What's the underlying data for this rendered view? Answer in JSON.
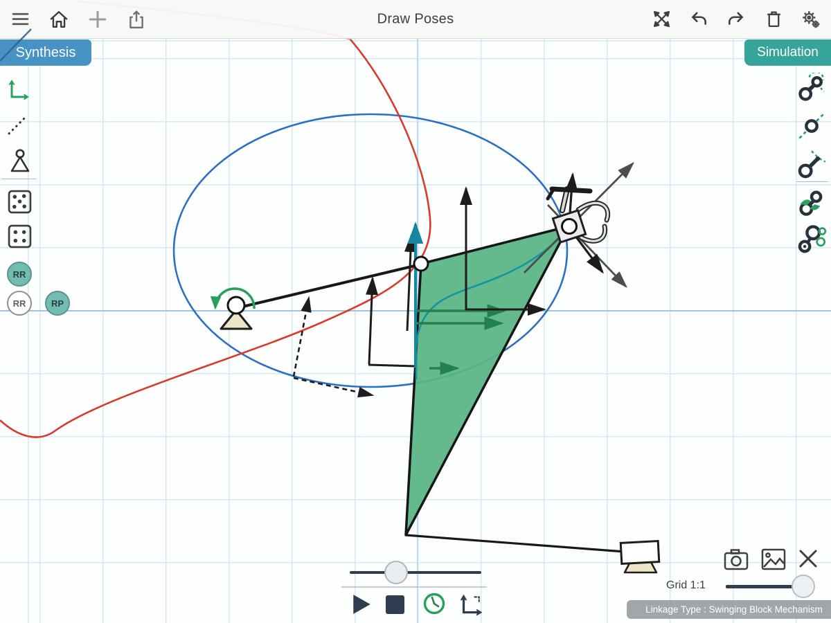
{
  "toolbar": {
    "title": "Draw Poses",
    "left_icons": [
      "menu-icon",
      "home-icon",
      "plus-icon",
      "share-icon"
    ],
    "right_icons": [
      "expand-icon",
      "undo-icon",
      "redo-icon",
      "trash-icon",
      "settings-gears-icon"
    ]
  },
  "panels": {
    "synthesis_label": "Synthesis",
    "simulation_label": "Simulation"
  },
  "left_toolbar": {
    "icons": [
      "pose-axis-icon",
      "dashed-line-icon",
      "ground-pivot-icon",
      "scatter-points-icon",
      "four-points-icon"
    ],
    "badges": {
      "rr_filled": "RR",
      "rr_outline": "RR",
      "rp_filled": "RP"
    }
  },
  "right_toolbar": {
    "icons": [
      "rr-dyad-icon",
      "prismatic-joint-icon",
      "rp-dyad-icon",
      "dyad-grab-icon",
      "triad-icon"
    ]
  },
  "playback": {
    "icons": [
      "play-icon",
      "stop-icon",
      "clock-icon",
      "frame-icon"
    ]
  },
  "bottom_right": {
    "icons": [
      "camera-icon",
      "image-icon",
      "close-icon"
    ],
    "grid_label": "Grid 1:1",
    "linkage_type_label": "Linkage Type : Swinging Block Mechanism"
  },
  "canvas": {
    "colors": {
      "coupler_curve_red": "#d93a2b",
      "moving_pivot_circle_blue": "#2b6fc4",
      "coupler_fill_green": "#58b583",
      "path_teal": "#1593a0",
      "velocity_arrow_green": "#23804f",
      "rotation_arc_green": "#27a05c",
      "grid_blue": "#d4e9f8",
      "axis_blue": "#a6c3da",
      "slider_navy": "#2e3e50",
      "synthesis_blue": "#398bc2",
      "simulation_teal": "#2aa096"
    }
  }
}
